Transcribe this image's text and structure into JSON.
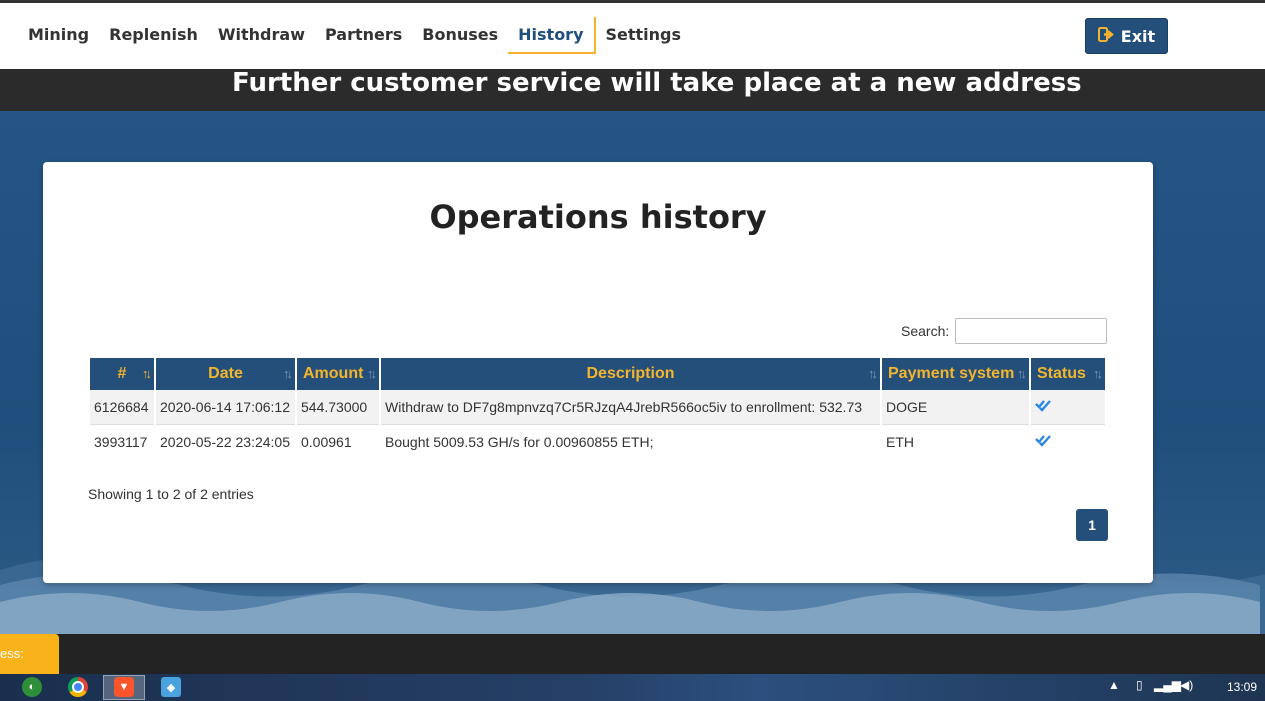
{
  "nav": {
    "items": [
      "Mining",
      "Replenish",
      "Withdraw",
      "Partners",
      "Bonuses",
      "History",
      "Settings"
    ],
    "active": "History",
    "exit_label": "Exit"
  },
  "banner": {
    "text": "Further customer service will take place at a new address"
  },
  "history": {
    "title": "Operations history",
    "search_label": "Search:",
    "search_value": "",
    "columns": [
      "#",
      "Date",
      "Amount",
      "Description",
      "Payment system",
      "Status"
    ],
    "rows": [
      {
        "id": "6126684",
        "date": "2020-06-14 17:06:12",
        "amount": "544.73000",
        "description": "Withdraw to DF7g8mpnvzq7Cr5RJzqA4JrebR566oc5iv to enrollment: 532.73",
        "payment_system": "DOGE",
        "status_icon": "double-check-icon"
      },
      {
        "id": "3993117",
        "date": "2020-05-22 23:24:05",
        "amount": "0.00961",
        "description": "Bought 5009.53 GH/s for 0.00960855 ETH;",
        "payment_system": "ETH",
        "status_icon": "double-check-icon"
      }
    ],
    "showing_text": "Showing 1 to 2 of 2 entries",
    "current_page": "1"
  },
  "footer": {
    "yellow_tab_text": "ess:"
  },
  "taskbar": {
    "clock": "13:09"
  },
  "colors": {
    "accent": "#f4b52c",
    "primary": "#234f7a",
    "check": "#2a89e0"
  }
}
